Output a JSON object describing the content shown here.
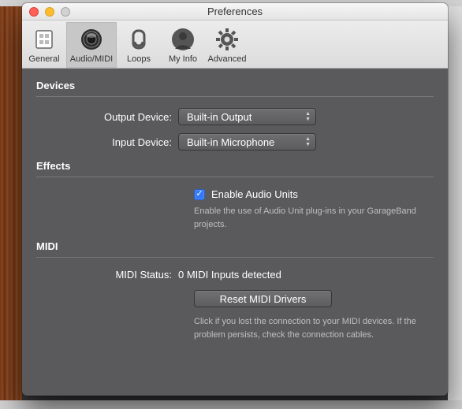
{
  "window": {
    "title": "Preferences"
  },
  "toolbar": {
    "items": [
      {
        "label": "General"
      },
      {
        "label": "Audio/MIDI"
      },
      {
        "label": "Loops"
      },
      {
        "label": "My Info"
      },
      {
        "label": "Advanced"
      }
    ]
  },
  "devices": {
    "heading": "Devices",
    "output_label": "Output Device:",
    "output_value": "Built-in Output",
    "input_label": "Input Device:",
    "input_value": "Built-in Microphone"
  },
  "effects": {
    "heading": "Effects",
    "enable_label": "Enable Audio Units",
    "enable_checked": true,
    "hint": "Enable the use of Audio Unit plug-ins in your GarageBand projects."
  },
  "midi": {
    "heading": "MIDI",
    "status_label": "MIDI Status:",
    "status_value": "0 MIDI Inputs detected",
    "reset_label": "Reset MIDI Drivers",
    "hint": "Click if you lost the connection to your MIDI devices. If the problem persists, check the connection cables."
  }
}
